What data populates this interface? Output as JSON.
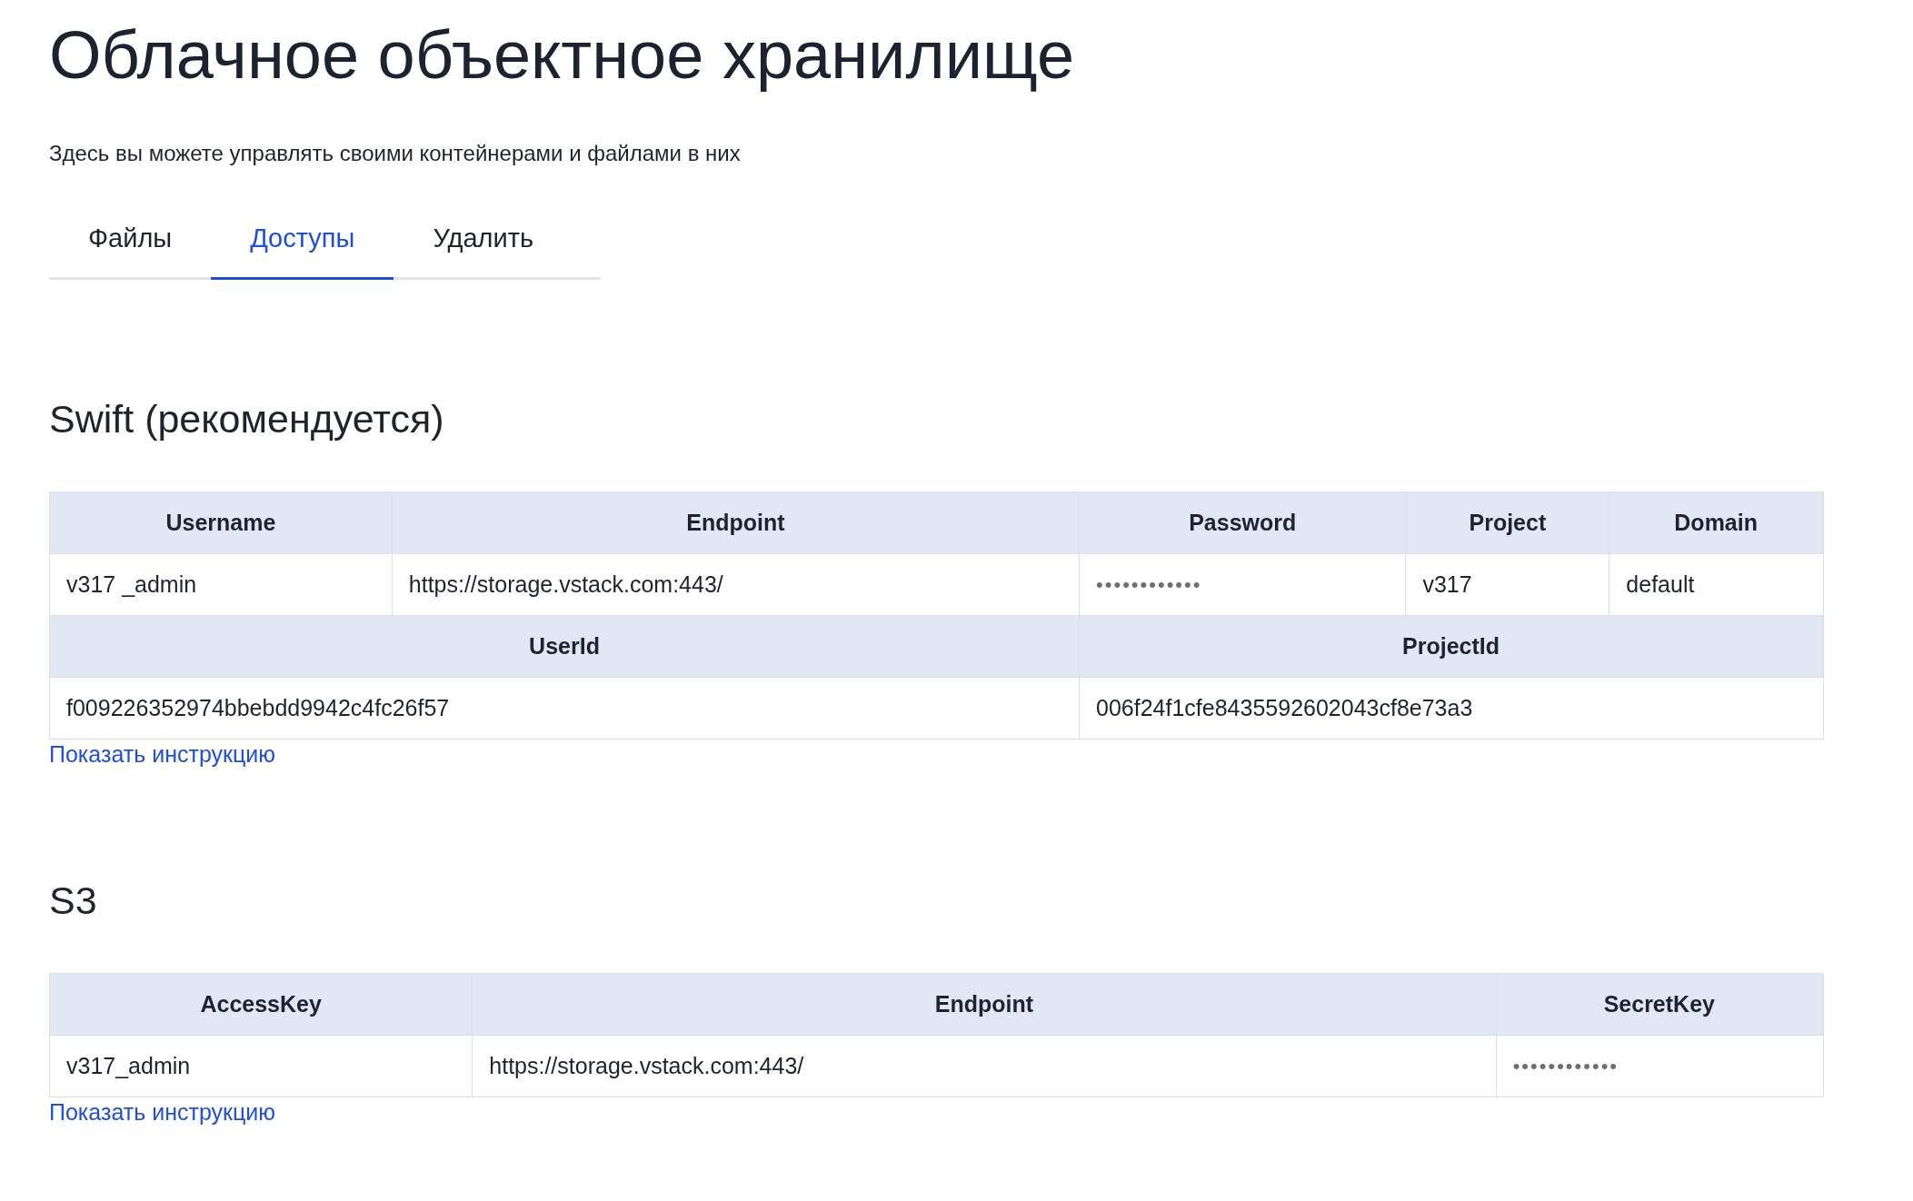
{
  "title": "Облачное объектное хранилище",
  "subtitle": "Здесь вы можете управлять своими контейнерами и файлами в них",
  "tabs": [
    {
      "label": "Файлы",
      "selected": false
    },
    {
      "label": "Доступы",
      "selected": true
    },
    {
      "label": "Удалить",
      "selected": false
    }
  ],
  "sections": [
    {
      "heading": "Swift (рекомендуется)",
      "groups": [
        {
          "columns": [
            {
              "label": "Username",
              "value": "v317 _admin",
              "masked": false
            },
            {
              "label": "Endpoint",
              "value": "https://storage.vstack.com:443/",
              "masked": false
            },
            {
              "label": "Password",
              "value": "••••••••••••",
              "masked": true
            },
            {
              "label": "Project",
              "value": "v317",
              "masked": false
            },
            {
              "label": "Domain",
              "value": "default",
              "masked": false
            }
          ]
        },
        {
          "columns": [
            {
              "label": "UserId",
              "value": "f009226352974bbebdd9942c4fc26f57",
              "masked": false
            },
            {
              "label": "ProjectId",
              "value": "006f24f1cfe8435592602043cf8e73a3",
              "masked": false
            }
          ]
        }
      ],
      "link": "Показать инструкцию"
    },
    {
      "heading": "S3",
      "groups": [
        {
          "columns": [
            {
              "label": "AccessKey",
              "value": "v317_admin",
              "masked": false
            },
            {
              "label": "Endpoint",
              "value": "https://storage.vstack.com:443/",
              "masked": false
            },
            {
              "label": "SecretKey",
              "value": "••••••••••••",
              "masked": true
            }
          ]
        }
      ],
      "link": "Показать инструкцию"
    }
  ]
}
